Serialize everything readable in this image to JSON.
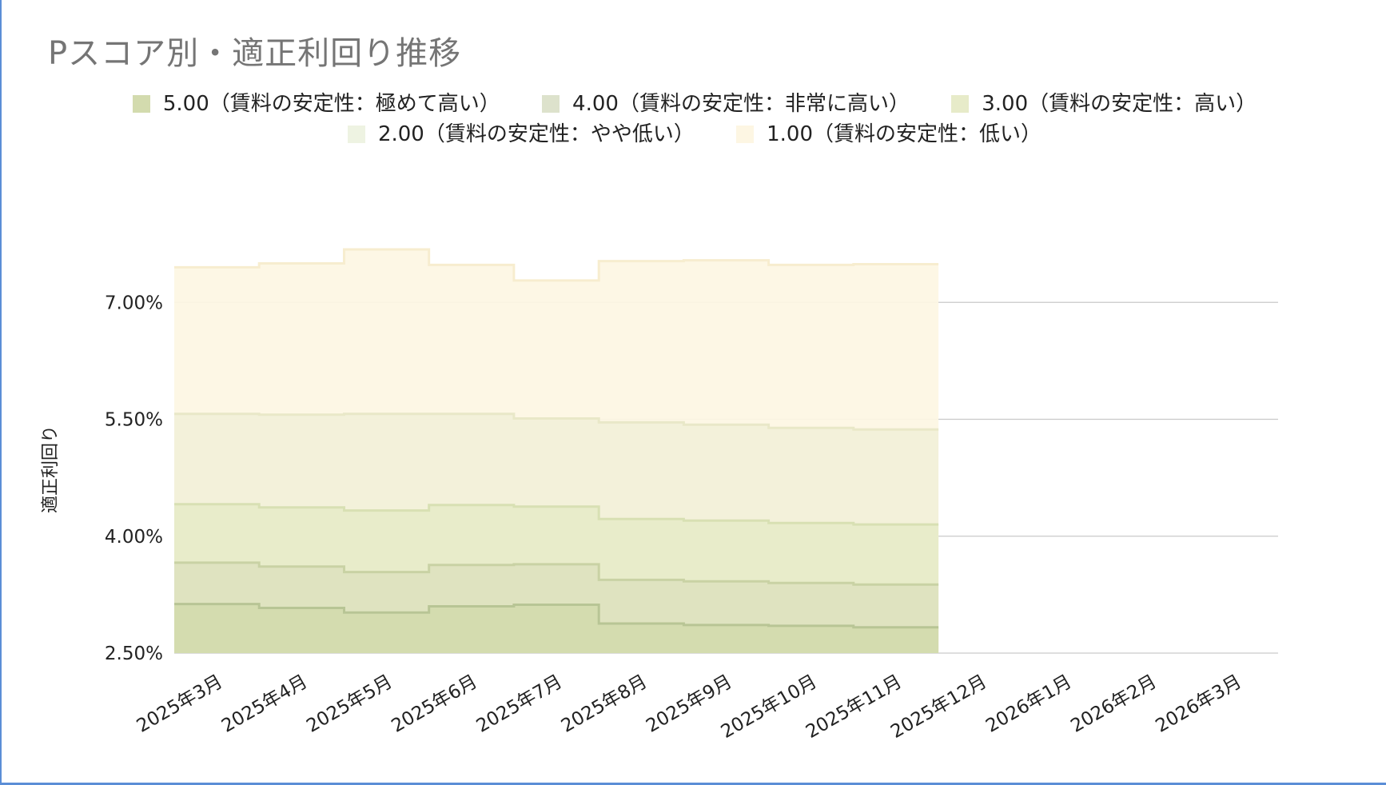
{
  "chart_data": {
    "type": "area",
    "step": true,
    "stacked": false,
    "title": "Pスコア別・適正利回り推移",
    "xlabel": "",
    "ylabel": "適正利回り",
    "ylim": [
      2.5,
      7.5
    ],
    "yticks": [
      "2.50%",
      "4.00%",
      "5.50%",
      "7.00%"
    ],
    "ytick_values": [
      2.5,
      4.0,
      5.5,
      7.0
    ],
    "grid": true,
    "legend_position": "top",
    "categories": [
      "2025年3月",
      "2025年4月",
      "2025年5月",
      "2025年6月",
      "2025年7月",
      "2025年8月",
      "2025年9月",
      "2025年10月",
      "2025年11月",
      "2025年12月",
      "2026年1月",
      "2026年2月",
      "2026年3月"
    ],
    "series": [
      {
        "name": "1.00（賃料の安定性：低い）",
        "color": "#fdf6e3",
        "line_color": "#f7edcf",
        "values": [
          7.45,
          7.5,
          7.68,
          7.48,
          7.28,
          7.53,
          7.54,
          7.48,
          7.49,
          null,
          null,
          null,
          null
        ]
      },
      {
        "name": "2.00（賃料の安定性：やや低い）",
        "color": "#f2f0d9",
        "line_color": "#e9e8c8",
        "values": [
          5.57,
          5.56,
          5.57,
          5.57,
          5.51,
          5.46,
          5.43,
          5.39,
          5.37,
          null,
          null,
          null,
          null
        ]
      },
      {
        "name": "3.00（賃料の安定性：高い）",
        "color": "#e7ebc9",
        "line_color": "#d8e0b3",
        "values": [
          4.41,
          4.37,
          4.33,
          4.4,
          4.38,
          4.22,
          4.2,
          4.17,
          4.15,
          null,
          null,
          null,
          null
        ]
      },
      {
        "name": "4.00（賃料の安定性：非常に高い）",
        "color": "#dde2bf",
        "line_color": "#c9d2a4",
        "values": [
          3.66,
          3.61,
          3.54,
          3.63,
          3.64,
          3.44,
          3.42,
          3.4,
          3.38,
          null,
          null,
          null,
          null
        ]
      },
      {
        "name": "5.00（賃料の安定性：極めて高い）",
        "color": "#d3dbae",
        "line_color": "#b8c595",
        "values": [
          3.13,
          3.08,
          3.02,
          3.1,
          3.12,
          2.88,
          2.86,
          2.85,
          2.83,
          null,
          null,
          null,
          null
        ]
      }
    ],
    "legend": [
      {
        "name": "5.00（賃料の安定性：極めて高い）",
        "color": "#d3dbae"
      },
      {
        "name": "4.00（賃料の安定性：非常に高い）",
        "color": "#dde2cc"
      },
      {
        "name": "3.00（賃料の安定性：高い）",
        "color": "#e7ebc9"
      },
      {
        "name": "2.00（賃料の安定性：やや低い）",
        "color": "#eef3e2"
      },
      {
        "name": "1.00（賃料の安定性：低い）",
        "color": "#fdf6e3"
      }
    ]
  }
}
